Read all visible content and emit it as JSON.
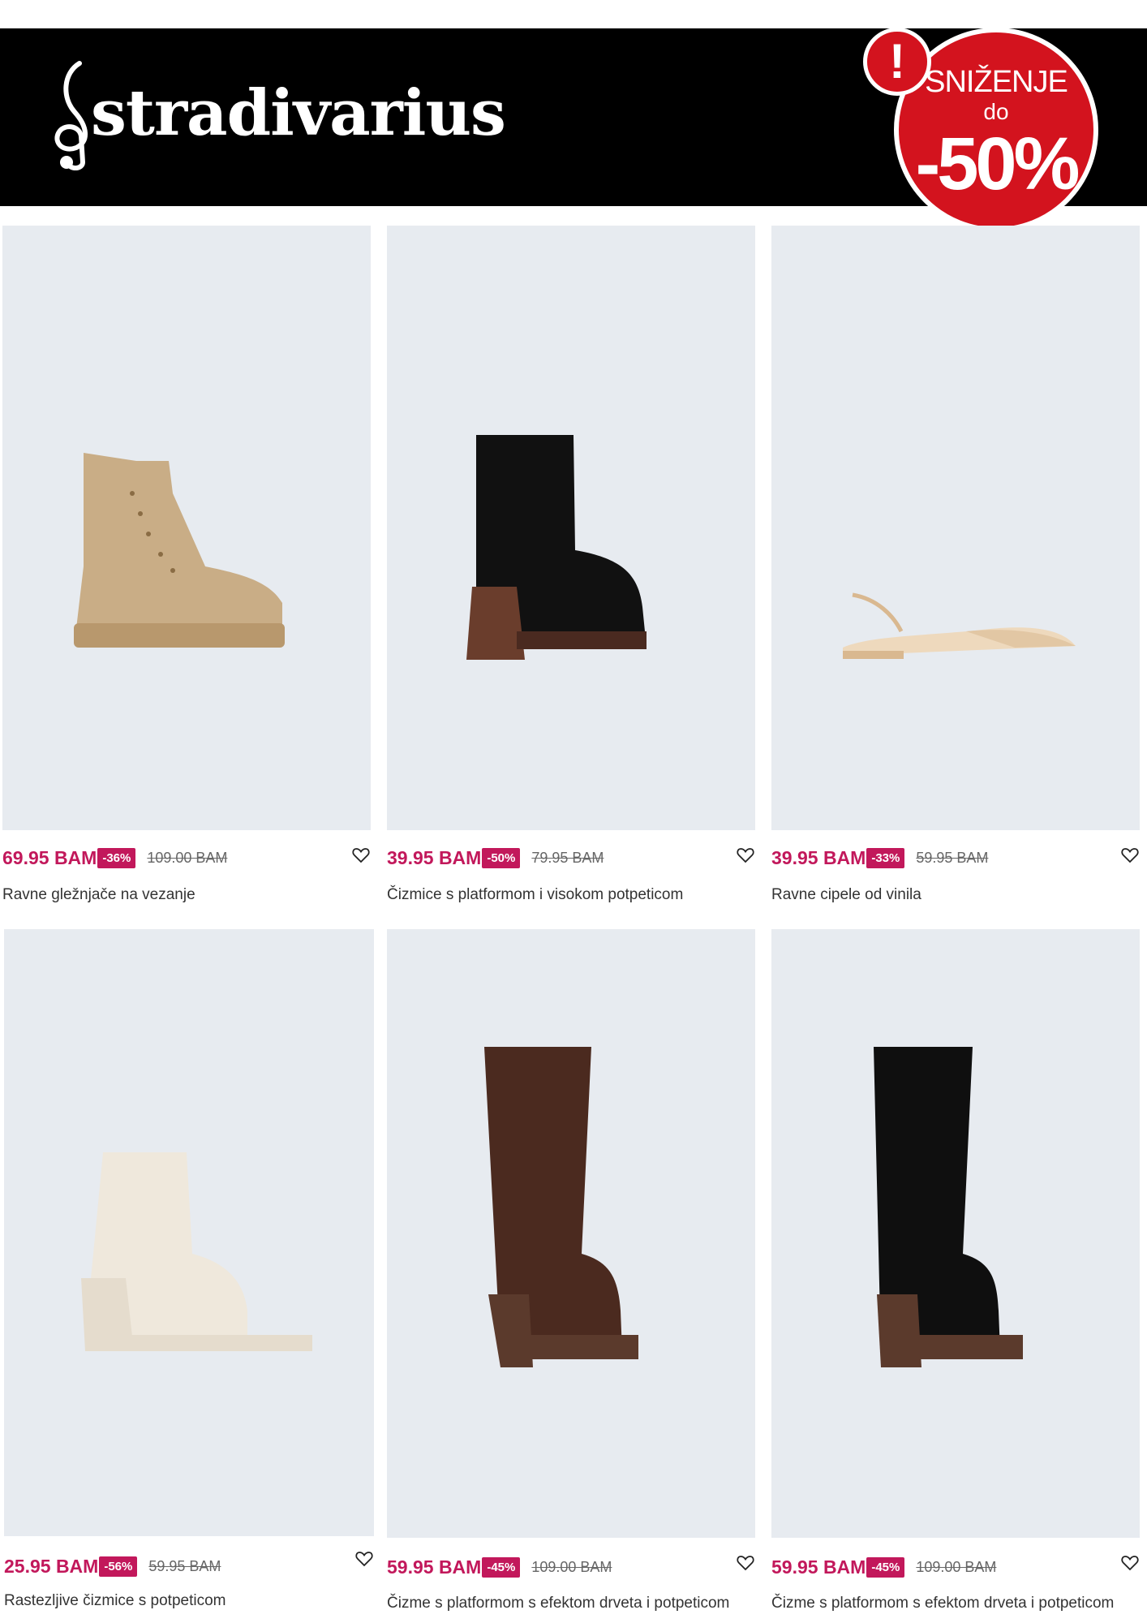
{
  "brand": {
    "name": "stradivarius",
    "logo_icon": "treble-clef-icon"
  },
  "promo": {
    "excl": "!",
    "line1": "SNIŽENJE",
    "line2": "do",
    "line3": "-50%",
    "color": "#d3131e"
  },
  "colors": {
    "accent": "#c2185b",
    "image_bg": "#e7ebf0"
  },
  "products": [
    {
      "price": "69.95 BAM",
      "discount": "-36%",
      "old_price": "109.00 BAM",
      "name": "Ravne gležnjače na vezanje",
      "wishlist_icon": "heart-icon"
    },
    {
      "price": "39.95 BAM",
      "discount": "-50%",
      "old_price": "79.95 BAM",
      "name": "Čizmice s platformom i visokom potpeticom",
      "wishlist_icon": "heart-icon"
    },
    {
      "price": "39.95 BAM",
      "discount": "-33%",
      "old_price": "59.95 BAM",
      "name": "Ravne cipele od vinila",
      "wishlist_icon": "heart-icon"
    },
    {
      "price": "25.95 BAM",
      "discount": "-56%",
      "old_price": "59.95 BAM",
      "name": "Rastezljive čizmice s potpeticom",
      "wishlist_icon": "heart-icon"
    },
    {
      "price": "59.95 BAM",
      "discount": "-45%",
      "old_price": "109.00 BAM",
      "name": "Čizme s platformom s efektom drveta i potpeticom",
      "wishlist_icon": "heart-icon"
    },
    {
      "price": "59.95 BAM",
      "discount": "-45%",
      "old_price": "109.00 BAM",
      "name": "Čizme s platformom s efektom drveta i potpeticom",
      "wishlist_icon": "heart-icon"
    }
  ]
}
